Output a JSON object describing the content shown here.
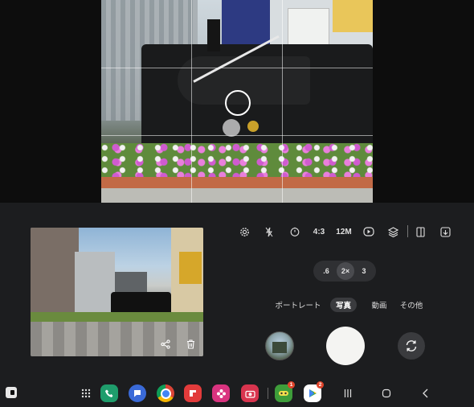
{
  "settings_bar": {
    "ratio_label": "4:3",
    "megapixel_label": "12M",
    "icons": [
      "settings-icon",
      "flash-off-icon",
      "timer-icon",
      "motion-photo-icon",
      "filter-icon",
      "layout-icon",
      "more-icon"
    ]
  },
  "zoom": {
    "options": [
      ".6",
      "2×",
      "3"
    ],
    "selected": "2×"
  },
  "modes": {
    "items": [
      "ポートレート",
      "写真",
      "動画",
      "その他"
    ],
    "selected": "写真"
  },
  "preview_actions": [
    "share-icon",
    "trash-icon"
  ],
  "taskbar": {
    "apps": [
      {
        "name": "phone-app-icon",
        "color": "#1f9d6c"
      },
      {
        "name": "messages-app-icon",
        "color": "#3a6ad8"
      },
      {
        "name": "chrome-app-icon",
        "color": "#ffffff"
      },
      {
        "name": "flipboard-app-icon",
        "color": "#e23b3b"
      },
      {
        "name": "gallery-app-icon",
        "color": "#d9337f"
      },
      {
        "name": "camera-app-icon",
        "color": "#d8344e"
      }
    ],
    "recent": [
      {
        "name": "game-app-icon",
        "color": "#3e9d3a",
        "badge": "1"
      },
      {
        "name": "play-store-app-icon",
        "color": "#ffffff",
        "badge": "2"
      }
    ]
  },
  "colors": {
    "panel_bg": "#1c1d1f",
    "shutter": "#f4f4f2",
    "badge": "#e0442b"
  }
}
